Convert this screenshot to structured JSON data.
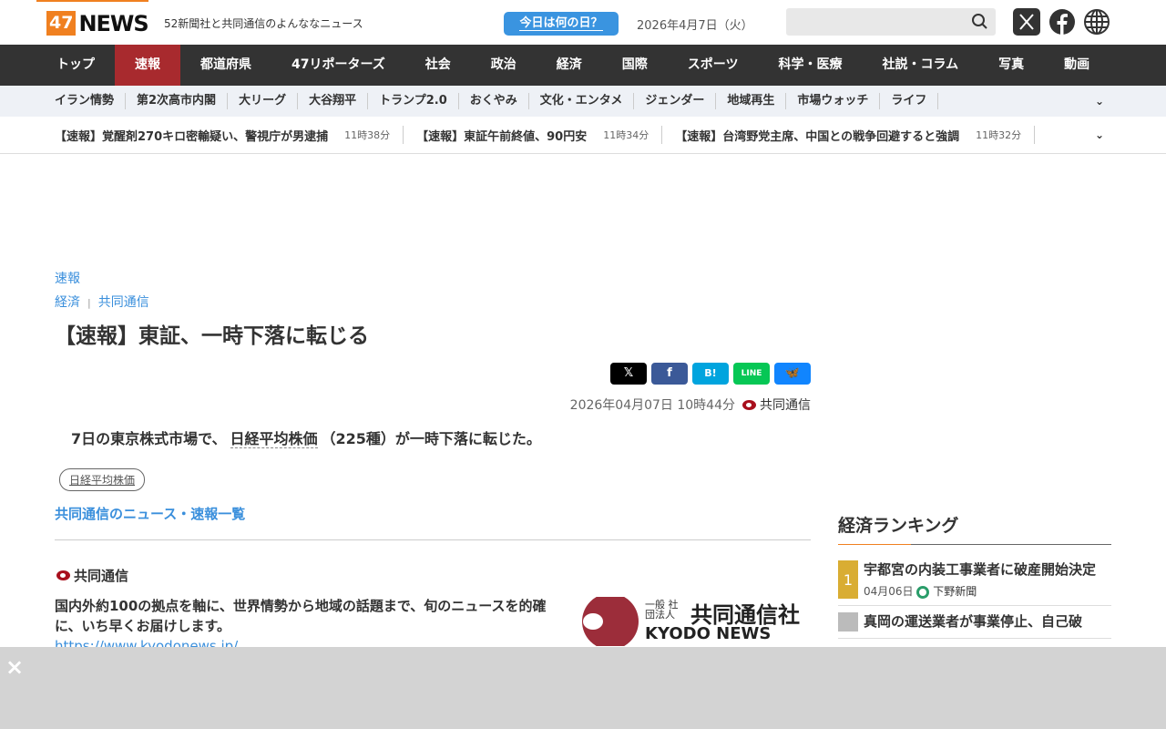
{
  "header": {
    "logo_num": "47",
    "logo_text": "NEWS",
    "tagline": "52新聞社と共同通信のよんななニュース",
    "today_button": "今日は何の日？",
    "date": "2026年4月7日（火）",
    "search_placeholder": ""
  },
  "nav": [
    "トップ",
    "速報",
    "都道府県",
    "47リポーターズ",
    "社会",
    "政治",
    "経済",
    "国際",
    "スポーツ",
    "科学・医療",
    "社説・コラム",
    "写真",
    "動画"
  ],
  "subnav": [
    "イラン情勢",
    "第2次高市内閣",
    "大リーグ",
    "大谷翔平",
    "トランプ2.0",
    "おくやみ",
    "文化・エンタメ",
    "ジェンダー",
    "地域再生",
    "市場ウォッチ",
    "ライフ"
  ],
  "ticker": [
    {
      "title": "【速報】覚醒剤270キロ密輸疑い、警視庁が男逮捕",
      "time": "11時38分"
    },
    {
      "title": "【速報】東証午前終値、90円安",
      "time": "11時34分"
    },
    {
      "title": "【速報】台湾野党主席、中国との戦争回避すると強調",
      "time": "11時32分"
    }
  ],
  "article": {
    "category": "速報",
    "sub_category": "経済",
    "source_category": "共同通信",
    "title": "【速報】東証、一時下落に転じる",
    "datetime": "2026年04月07日 10時44分",
    "source": "共同通信",
    "body_pre": "7日の東京株式市場で、",
    "body_keyword": "日経平均株価",
    "body_post": "（225種）が一時下落に転じた。",
    "tag": "日経平均株価",
    "list_link": "共同通信のニュース・速報一覧"
  },
  "share": {
    "x": "𝕏",
    "facebook": "f",
    "hatena": "B!",
    "line": "LINE",
    "bluesky": "🦋"
  },
  "source_box": {
    "name": "共同通信",
    "description": "国内外約100の拠点を軸に、世界情勢から地域の話題まで、旬のニュースを的確に、いち早くお届けします。",
    "url": "https://www.kyodonews.jp/",
    "logo_small": "一般 社団法人",
    "logo_name": "共同通信社",
    "logo_en": "KYODO NEWS",
    "logo_badge": "KYODO"
  },
  "ranking": {
    "title": "経済ランキング",
    "items": [
      {
        "rank": "1",
        "title": "宇都宮の内装工事業者に破産開始決定",
        "date": "04月06日",
        "source": "下野新聞"
      },
      {
        "rank": "",
        "title": "真岡の運送業者が事業停止、自己破"
      }
    ]
  },
  "ad": {
    "close": "×"
  }
}
